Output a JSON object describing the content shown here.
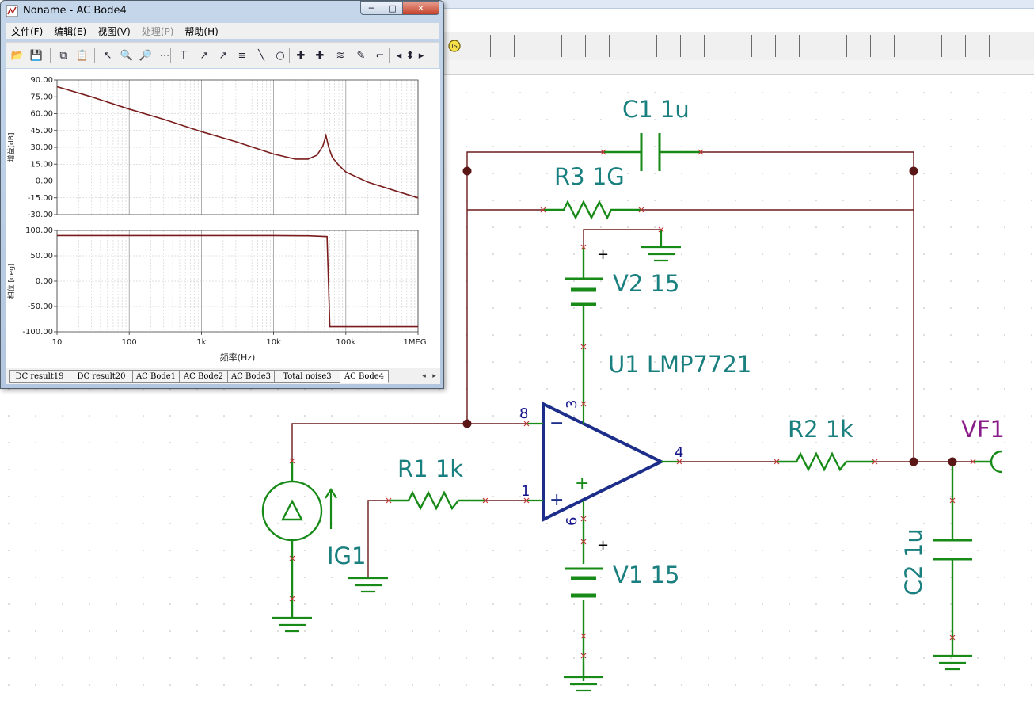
{
  "window": {
    "title": "Noname - AC Bode4",
    "minimize_glyph": "─",
    "maximize_glyph": "□",
    "close_glyph": "✕"
  },
  "menu": [
    {
      "label": "文件(F)",
      "enabled": true
    },
    {
      "label": "编辑(E)",
      "enabled": true
    },
    {
      "label": "视图(V)",
      "enabled": true
    },
    {
      "label": "处理(P)",
      "enabled": false
    },
    {
      "label": "帮助(H)",
      "enabled": true
    }
  ],
  "toolbar": {
    "buttons": [
      {
        "name": "open-icon",
        "glyph": "📂"
      },
      {
        "name": "save-icon",
        "glyph": "💾"
      },
      {
        "name": "copy-icon",
        "glyph": "⧉"
      },
      {
        "name": "paste-icon",
        "glyph": "📋"
      },
      {
        "name": "pointer-icon",
        "glyph": "↖"
      },
      {
        "name": "zoom-in-icon",
        "glyph": "🔍"
      },
      {
        "name": "zoom-out-icon",
        "glyph": "🔎"
      },
      {
        "name": "grid-icon",
        "glyph": "⋯"
      },
      {
        "name": "text-icon",
        "glyph": "T"
      },
      {
        "name": "label-a-icon",
        "glyph": "↗"
      },
      {
        "name": "label-b-icon",
        "glyph": "↗"
      },
      {
        "name": "axis-label-icon",
        "glyph": "≡"
      },
      {
        "name": "line-icon",
        "glyph": "╲"
      },
      {
        "name": "circle-icon",
        "glyph": "○"
      },
      {
        "name": "cursor-a-icon",
        "glyph": "✚"
      },
      {
        "name": "cursor-b-icon",
        "glyph": "✚"
      },
      {
        "name": "curves-icon",
        "glyph": "≋"
      },
      {
        "name": "marker-icon",
        "glyph": "✎"
      },
      {
        "name": "corner-icon",
        "glyph": "⌐"
      },
      {
        "name": "nav-left-icon",
        "glyph": "◂"
      },
      {
        "name": "nav-updown-icon",
        "glyph": "⬍"
      },
      {
        "name": "nav-right-icon",
        "glyph": "▸"
      }
    ]
  },
  "tabs": [
    {
      "label": "DC result19",
      "active": false
    },
    {
      "label": "DC result20",
      "active": false
    },
    {
      "label": "AC Bode1",
      "active": false
    },
    {
      "label": "AC Bode2",
      "active": false
    },
    {
      "label": "AC Bode3",
      "active": false
    },
    {
      "label": "Total noise3",
      "active": false
    },
    {
      "label": "AC Bode4",
      "active": true
    }
  ],
  "chart_data": [
    {
      "type": "line",
      "title": "",
      "xlabel": "",
      "ylabel": "增益[dB]",
      "x_scale": "log",
      "xlim": [
        10,
        1000000
      ],
      "ylim": [
        -30,
        90
      ],
      "yticks": [
        "90.00",
        "75.00",
        "60.00",
        "45.00",
        "30.00",
        "15.00",
        "0.00",
        "-15.00",
        "-30.00"
      ],
      "grid": true,
      "series": [
        {
          "color": "#7a1c1c",
          "x": [
            10,
            30,
            100,
            300,
            1000,
            3000,
            10000,
            20000,
            30000,
            40000,
            48000,
            53000,
            58000,
            65000,
            80000,
            100000,
            200000,
            500000,
            1000000
          ],
          "y": [
            84,
            75,
            64,
            55,
            44,
            35,
            24,
            19.5,
            19.5,
            23,
            31,
            40.5,
            30,
            21,
            14,
            8,
            -1,
            -9,
            -15
          ]
        }
      ]
    },
    {
      "type": "line",
      "title": "",
      "xlabel": "频率(Hz)",
      "ylabel": "相位 [deg]",
      "x_scale": "log",
      "xlim": [
        10,
        1000000
      ],
      "ylim": [
        -100,
        100
      ],
      "yticks": [
        "100.00",
        "50.00",
        "0.00",
        "-50.00",
        "-100.00"
      ],
      "xticks": [
        "10",
        "100",
        "1k",
        "10k",
        "100k",
        "1MEG"
      ],
      "grid": true,
      "series": [
        {
          "color": "#7a1c1c",
          "x": [
            10,
            1000,
            10000,
            30000,
            55000,
            60000,
            70000,
            100000,
            1000000
          ],
          "y": [
            90,
            90,
            90,
            89.5,
            88,
            -90,
            -90,
            -90,
            -90
          ]
        }
      ]
    }
  ],
  "schematic": {
    "labels": {
      "c1": "C1 1u",
      "r3": "R3 1G",
      "v2": "V2 15",
      "u1": "U1 LMP7721",
      "r2": "R2 1k",
      "vf1": "VF1",
      "r1": "R1 1k",
      "ig1": "IG1",
      "v1": "V1 15",
      "c2": "C2 1u"
    },
    "pins": {
      "p8": "8",
      "p3": "3",
      "p4": "4",
      "p1": "1",
      "p6": "6"
    },
    "signs": {
      "minus": "−",
      "plus": "+",
      "v2_plus": "+",
      "v1_plus": "+"
    },
    "colors": {
      "wire": "#6b1b1b",
      "component": "#178a17",
      "label": "#1a7f7f",
      "pin": "#13138a",
      "opamp": "#1c2d8a",
      "meter": "#8a1c8a",
      "junction": "#5a1515",
      "x_mark": "#c43a3a"
    }
  }
}
